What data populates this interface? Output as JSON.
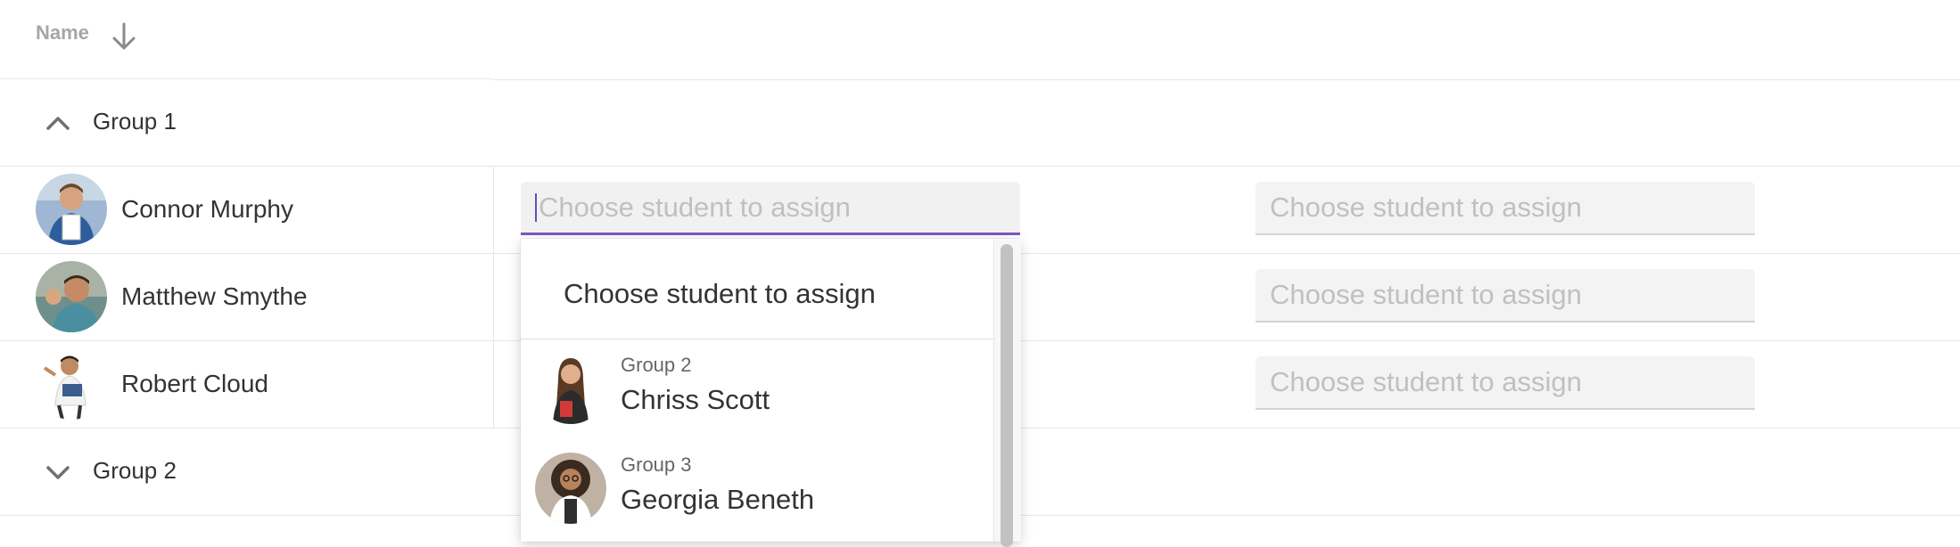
{
  "table": {
    "header": {
      "name_label": "Name",
      "sort_icon": "arrow-down-icon"
    },
    "groups": [
      {
        "label": "Group 1",
        "expanded": true,
        "students": [
          {
            "name": "Connor Murphy",
            "placeholder": "Choose student to assign",
            "placeholder_2": "Choose student to assign"
          },
          {
            "name": "Matthew Smythe",
            "placeholder": "Choose student to assign",
            "placeholder_2": "Choose student to assign"
          },
          {
            "name": "Robert Cloud",
            "placeholder": "Choose student to assign",
            "placeholder_2": "Choose student to assign"
          }
        ]
      },
      {
        "label": "Group 2",
        "expanded": false
      }
    ]
  },
  "dropdown": {
    "header": "Choose student to assign",
    "items": [
      {
        "group": "Group 2",
        "name": "Chriss Scott"
      },
      {
        "group": "Group 3",
        "name": "Georgia Beneth"
      }
    ]
  },
  "colors": {
    "accent": "#7e57c2",
    "placeholder": "#c0c0c0",
    "divider": "#e6e6e6"
  }
}
